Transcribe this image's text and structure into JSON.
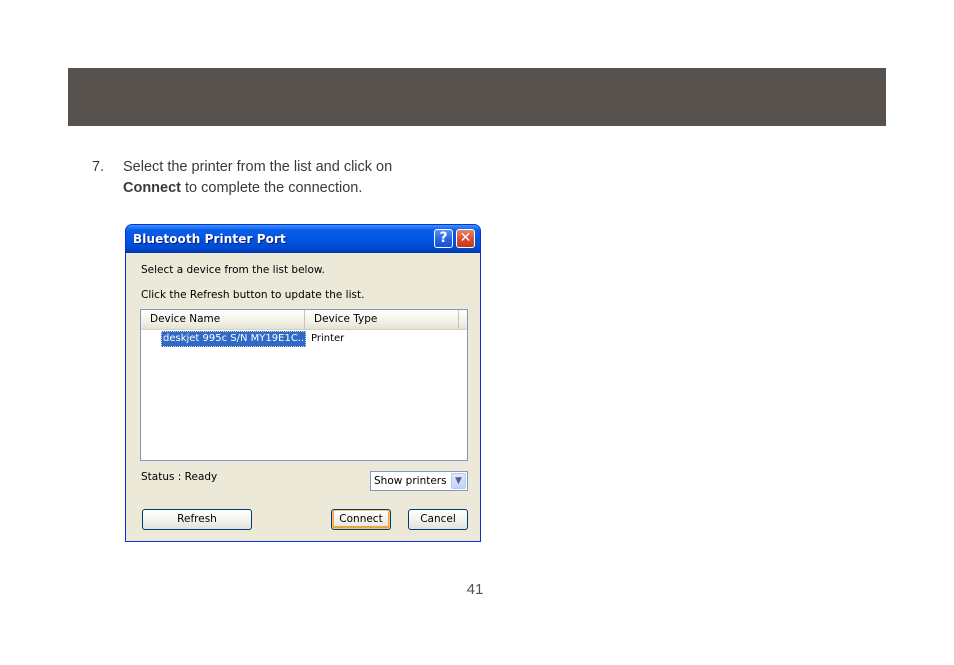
{
  "step": {
    "number": "7.",
    "line1": "Select the printer from the list and click on",
    "bold_word": "Connect",
    "line2_rest": " to complete the connection."
  },
  "dialog": {
    "title": "Bluetooth Printer Port",
    "help_glyph": "?",
    "close_glyph": "✕",
    "instruction1": "Select a device from the list below.",
    "instruction2": "Click the Refresh button to update the list.",
    "columns": [
      "Device Name",
      "Device Type"
    ],
    "rows": [
      {
        "name": "deskjet 995c S/N MY19E1C...",
        "type": "Printer",
        "selected": true
      }
    ],
    "status": "Status : Ready",
    "filter_select": {
      "value": "Show printers"
    },
    "buttons": {
      "refresh": "Refresh",
      "connect": "Connect",
      "cancel": "Cancel"
    }
  },
  "page_number": "41",
  "colors": {
    "banner": "#58524e",
    "titlebar": "#0054e3",
    "dialog_face": "#ece9d8",
    "selection": "#316ac5"
  }
}
